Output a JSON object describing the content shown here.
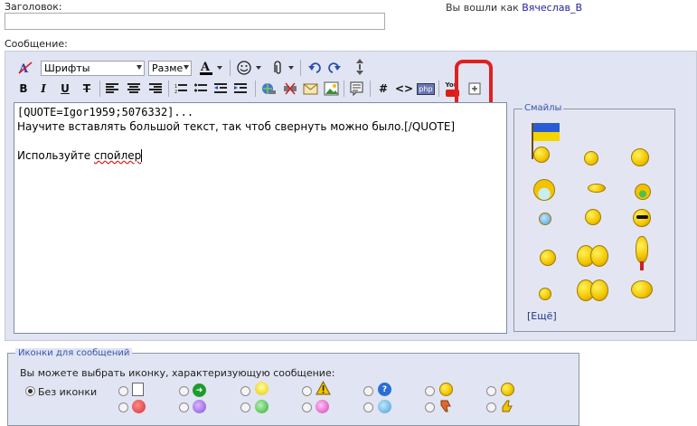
{
  "form": {
    "title_label": "Заголовок:",
    "message_label": "Сообщение:",
    "logged_prefix": "Вы вошли как",
    "username": "Вячеслав_В"
  },
  "toolbar": {
    "font_select": "Шрифты",
    "size_select": "Разме",
    "bold": "B",
    "italic": "I",
    "underline": "U",
    "strike": "T",
    "hash": "#",
    "code": "<>",
    "youtube": "You",
    "php": "php"
  },
  "editor": {
    "lines": [
      "[QUOTE=Igor1959;5076332]...",
      "Научите вставлять большой текст, так чтоб свернуть можно было.[/QUOTE]",
      "",
      "Используйте спойлер"
    ],
    "line4_plain": "Используйте ",
    "line4_spell": "спойлер"
  },
  "smilies": {
    "legend": "Смайлы",
    "more": "[Ещё]"
  },
  "post_icons": {
    "legend": "Иконки для сообщений",
    "prompt": "Вы можете выбрать иконку, характеризующую сообщение:",
    "no_icon": "Без иконки"
  },
  "colors": {
    "annotation_red": "#e02020",
    "link_blue": "#22229c",
    "panel_bg": "#e1e4f2"
  }
}
